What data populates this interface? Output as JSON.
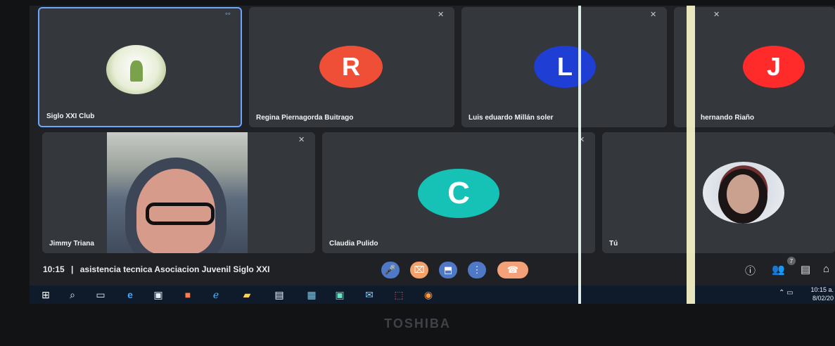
{
  "participants": {
    "p1": {
      "name": "Siglo XXI Club"
    },
    "p2": {
      "name": "Regina Piernagorda Buitrago",
      "initial": "R",
      "color": "#f04f37"
    },
    "p3": {
      "name": "Luis eduardo Millán soler",
      "initial": "L",
      "color": "#1f3ed3"
    },
    "p4": {
      "name": "hernando Riaño",
      "initial": "J",
      "color": "#ff2b2b"
    },
    "p5": {
      "name": "Jimmy Triana"
    },
    "p6": {
      "name": "Claudia Pulido",
      "initial": "C",
      "color": "#16c1b5"
    },
    "p7": {
      "name": "Tú"
    }
  },
  "meeting": {
    "time": "10:15",
    "separator": "|",
    "title": "asistencia tecnica Asociacion Juvenil Siglo XXI"
  },
  "controls": [
    {
      "icon": "mic-icon",
      "label": "🎤"
    },
    {
      "icon": "camera-off-icon",
      "label": "⌧"
    },
    {
      "icon": "present-icon",
      "label": "⬒"
    },
    {
      "icon": "more-icon",
      "label": "⋮"
    },
    {
      "icon": "hangup-icon",
      "label": "☎"
    }
  ],
  "right_controls": [
    {
      "icon": "info-icon",
      "label": "ⓘ"
    },
    {
      "icon": "people-icon",
      "label": "👥"
    },
    {
      "icon": "chat-icon",
      "label": "▤"
    },
    {
      "icon": "activities-icon",
      "label": "⌂"
    }
  ],
  "people_count": "7",
  "taskbar": {
    "time": "10:15 a.",
    "date": "8/02/20"
  },
  "brand": "TOSHIBA",
  "icons": {
    "muted": "muted-icon",
    "speaking": "speaking-icon"
  }
}
